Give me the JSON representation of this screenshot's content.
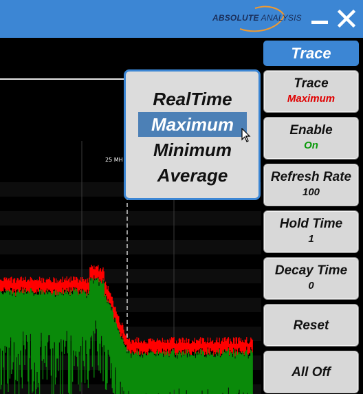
{
  "titlebar": {
    "logo_word1": "ABSOLUTE",
    "logo_word2": "ANALYSIS",
    "minimize_icon": "minimize-icon",
    "close_icon": "close-icon"
  },
  "plot": {
    "marker_label": "25 MH",
    "series_colors": {
      "maximum": "#ff0000",
      "average": "#0a8a0a"
    }
  },
  "panel": {
    "header": "Trace",
    "buttons": [
      {
        "label": "Trace",
        "value": "Maximum"
      },
      {
        "label": "Enable",
        "value": "On"
      },
      {
        "label": "Refresh Rate",
        "value": "100"
      },
      {
        "label": "Hold Time",
        "value": "1"
      },
      {
        "label": "Decay Time",
        "value": "0"
      },
      {
        "label": "Reset"
      },
      {
        "label": "All Off"
      }
    ]
  },
  "menu": {
    "items": [
      "RealTime",
      "Maximum",
      "Minimum",
      "Average"
    ],
    "selected": "Maximum"
  },
  "colors": {
    "accent": "#3c86d4",
    "selected": "#4c80b6",
    "value_red": "#e00000",
    "value_green": "#0a9a0a"
  }
}
